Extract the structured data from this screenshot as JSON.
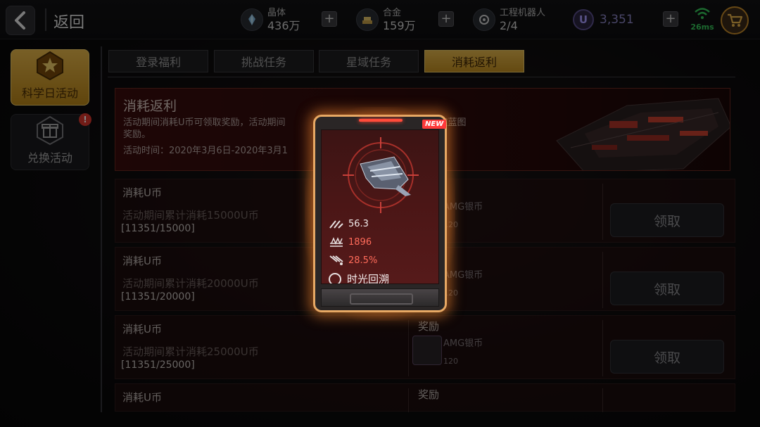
{
  "topbar": {
    "back_label": "返回",
    "resources": [
      {
        "name": "晶体",
        "value": "436万",
        "icon": "crystal-icon"
      },
      {
        "name": "合金",
        "value": "159万",
        "icon": "alloy-icon"
      },
      {
        "name": "工程机器人",
        "value": "2/4",
        "icon": "robot-icon"
      }
    ],
    "u_coin": {
      "symbol": "U",
      "value": "3,351"
    },
    "ping": "26ms"
  },
  "sidebar": {
    "items": [
      {
        "label": "科学日活动",
        "active": true
      },
      {
        "label": "兑换活动",
        "active": false,
        "badge": "!"
      }
    ]
  },
  "tabs": [
    {
      "label": "登录福利",
      "active": false
    },
    {
      "label": "挑战任务",
      "active": false
    },
    {
      "label": "星域任务",
      "active": false
    },
    {
      "label": "消耗返利",
      "active": true
    }
  ],
  "banner": {
    "title": "消耗返利",
    "desc_left": "活动期间消耗U币可领取奖励，活动期间",
    "desc_right": "可领取蓝图",
    "desc_line2": "奖励。",
    "time": "活动时间：2020年3月6日-2020年3月1"
  },
  "rows": [
    {
      "title": "消耗U币",
      "desc": "活动期间累计消耗15000U币",
      "progress": "[11351/15000]",
      "reward_label": "",
      "item_name": "AMG银币",
      "item_qty": "120",
      "button": "领取"
    },
    {
      "title": "消耗U币",
      "desc": "活动期间累计消耗20000U币",
      "progress": "[11351/20000]",
      "reward_label": "",
      "item_name": "AMG银币",
      "item_qty": "120",
      "button": "领取"
    },
    {
      "title": "消耗U币",
      "desc": "活动期间累计消耗25000U币",
      "progress": "[11351/25000]",
      "reward_label": "奖励",
      "item_name": "AMG银币",
      "item_qty": "120",
      "button": "领取"
    },
    {
      "title": "消耗U币",
      "desc": "",
      "progress": "",
      "reward_label": "奖励",
      "item_name": "",
      "item_qty": "",
      "button": ""
    }
  ],
  "card": {
    "badge": "NEW",
    "stats": [
      {
        "value": "56.3",
        "color": "#f0eaea"
      },
      {
        "value": "1896",
        "color": "#ff6b5a"
      },
      {
        "value": "28.5%",
        "color": "#ff6b5a"
      }
    ],
    "skill": "时光回溯"
  },
  "colors": {
    "accent_gold": "#e2b54b",
    "card_border": "#e7a864",
    "ping_green": "#36c95a",
    "u_coin_purple": "#8c86c8"
  }
}
